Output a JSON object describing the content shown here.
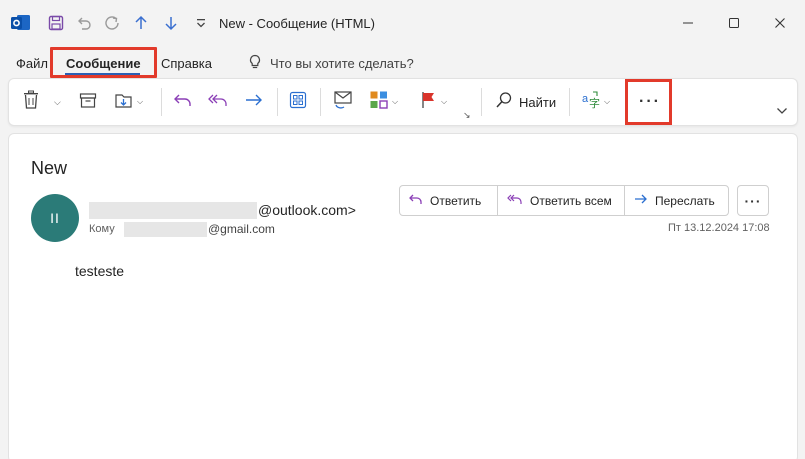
{
  "window": {
    "title": "New  -  Сообщение (HTML)",
    "app_icon": "outlook-icon",
    "quick_access": [
      "save-icon",
      "undo-icon",
      "redo-icon",
      "arrow-up-icon",
      "arrow-down-icon",
      "customize-icon"
    ],
    "controls": [
      "minimize-icon",
      "maximize-icon",
      "close-icon"
    ]
  },
  "menu": {
    "tabs": [
      {
        "label": "Файл"
      },
      {
        "label": "Сообщение"
      },
      {
        "label": "Справка"
      }
    ],
    "active_tab": "Сообщение",
    "tell_me": "Что вы хотите сделать?"
  },
  "ribbon": {
    "find_label": "Найти",
    "more_label": "···",
    "icons": [
      "delete-icon",
      "archive-icon",
      "move-icon",
      "reply-icon",
      "reply-all-icon",
      "forward-icon",
      "apps-icon",
      "mark-unread-icon",
      "categorize-icon",
      "flag-icon",
      "find-icon",
      "translate-icon",
      "more-icon",
      "collapse-icon"
    ]
  },
  "message": {
    "subject": "New",
    "avatar_initials": "II",
    "from_suffix": "@outlook.com>",
    "to_label": "Кому",
    "to_suffix": "@gmail.com",
    "date": "Пт 13.12.2024 17:08",
    "body": "testeste",
    "actions": {
      "reply": "Ответить",
      "reply_all": "Ответить всем",
      "forward": "Переслать",
      "more": "···"
    }
  },
  "colors": {
    "accent": "#2b5fb4",
    "highlight": "#e23a2b",
    "avatar": "#2b7b78",
    "reply_icon": "#8b3fb6",
    "forward_icon": "#2b6fd0"
  }
}
